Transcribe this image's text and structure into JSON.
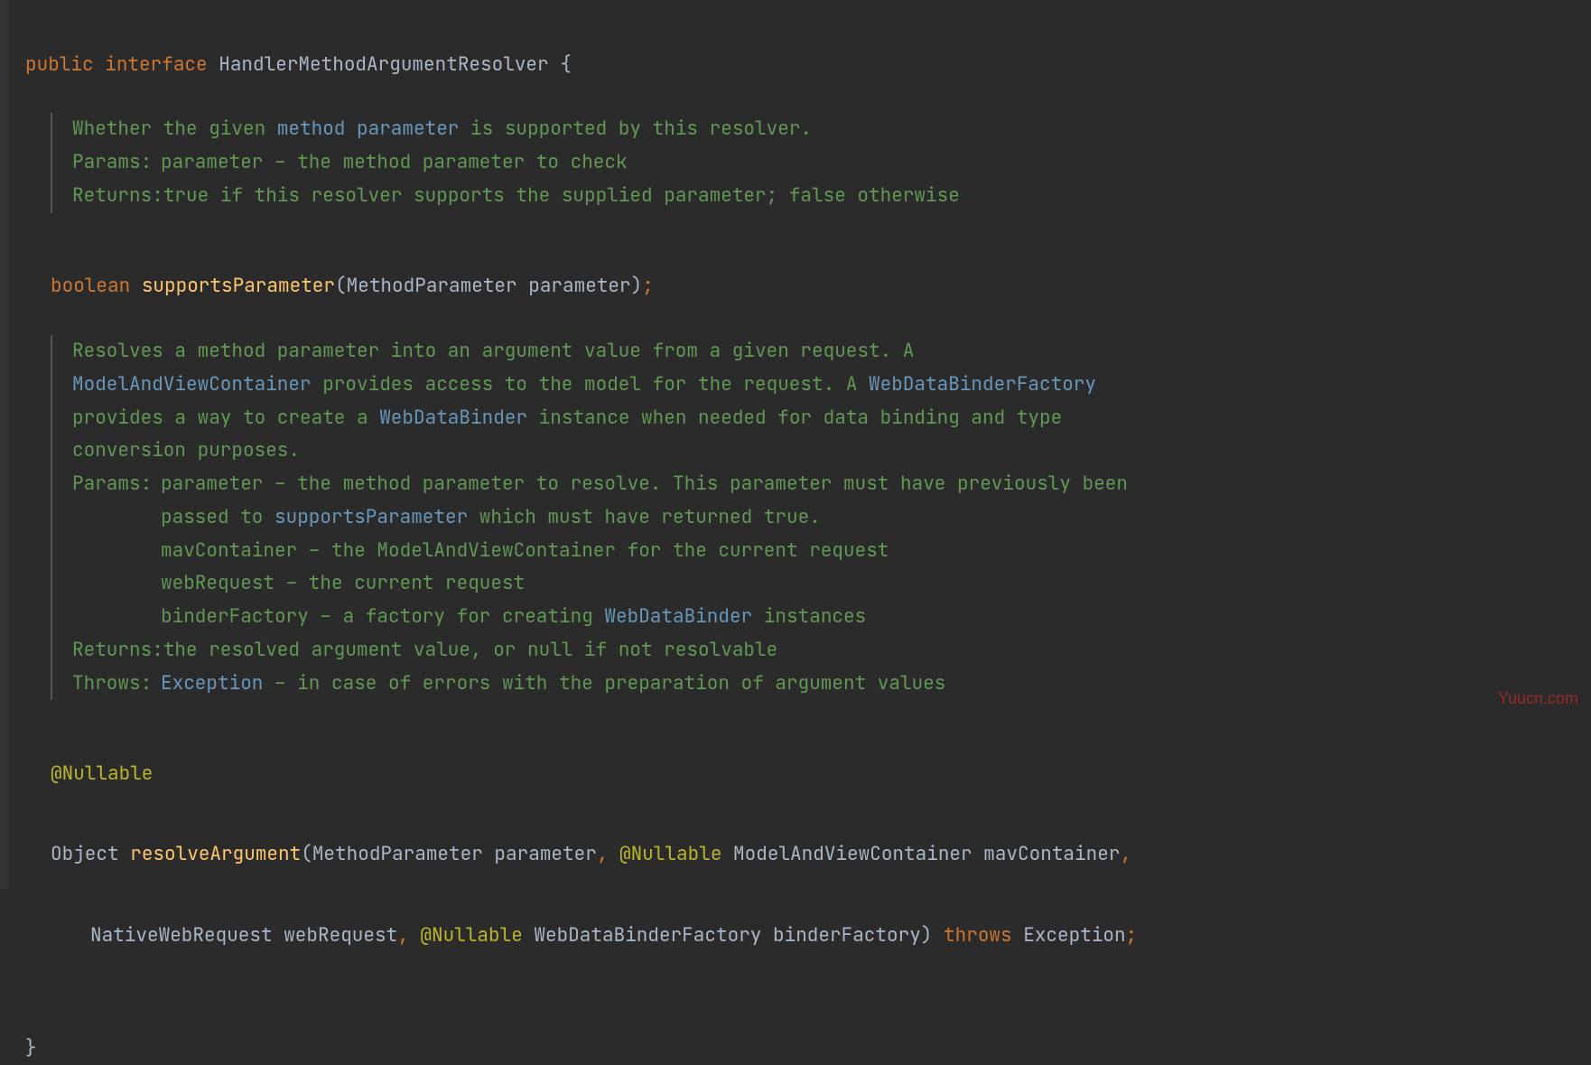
{
  "decl": {
    "public": "public",
    "interface": "interface",
    "name": "HandlerMethodArgumentResolver",
    "open": "{",
    "close": "}"
  },
  "doc1": {
    "line1a": "Whether the given ",
    "link1": "method parameter",
    "line1b": " is supported by this resolver.",
    "params_label": "Params:",
    "params_body": "parameter – the method parameter to check",
    "returns_label": "Returns:",
    "returns_body_a": "true",
    "returns_body_mid": " if this resolver supports the supplied parameter; ",
    "returns_body_b": "false",
    "returns_body_end": " otherwise"
  },
  "method1": {
    "ret": "boolean",
    "name": "supportsParameter",
    "sig_a": "(MethodParameter parameter)",
    "semi": ";"
  },
  "doc2": {
    "para_a": "Resolves a method parameter into an argument value from a given request. A ",
    "link_mavc": "ModelAndViewContainer",
    "para_b": " provides access to the model for the request. A ",
    "link_wdbf": "WebDataBinderFactory",
    "para_c": " provides a way to create a ",
    "link_wdb": "WebDataBinder",
    "para_d": " instance when needed for data binding and type conversion purposes.",
    "params_label": "Params:",
    "p1a": "parameter – the method parameter to resolve. This parameter must have previously been passed to ",
    "p1_link": "supportsParameter",
    "p1b": " which must have returned ",
    "p1_true": "true",
    "p1c": ".",
    "p2": "mavContainer – the ModelAndViewContainer for the current request",
    "p3": "webRequest – the current request",
    "p4a": "binderFactory – a factory for creating ",
    "p4_link": "WebDataBinder",
    "p4b": " instances",
    "returns_label": "Returns:",
    "returns_a": "the resolved argument value, or ",
    "returns_null": "null",
    "returns_b": " if not resolvable",
    "throws_label": "Throws:",
    "throws_link": "Exception",
    "throws_body": " – in case of errors with the preparation of argument values"
  },
  "method2": {
    "annot": "@Nullable",
    "ret": "Object",
    "name": "resolveArgument",
    "sig_a": "(MethodParameter parameter",
    "comma1": ", ",
    "annot2": "@Nullable",
    "sig_b": " ModelAndViewContainer mavContainer",
    "comma2": ",",
    "sig_c": "NativeWebRequest webRequest",
    "comma3": ", ",
    "annot3": "@Nullable",
    "sig_d": " WebDataBinderFactory binderFactory) ",
    "throws_kw": "throws",
    "throws_type": " Exception",
    "semi": ";"
  },
  "watermark": "Yuucn.com"
}
